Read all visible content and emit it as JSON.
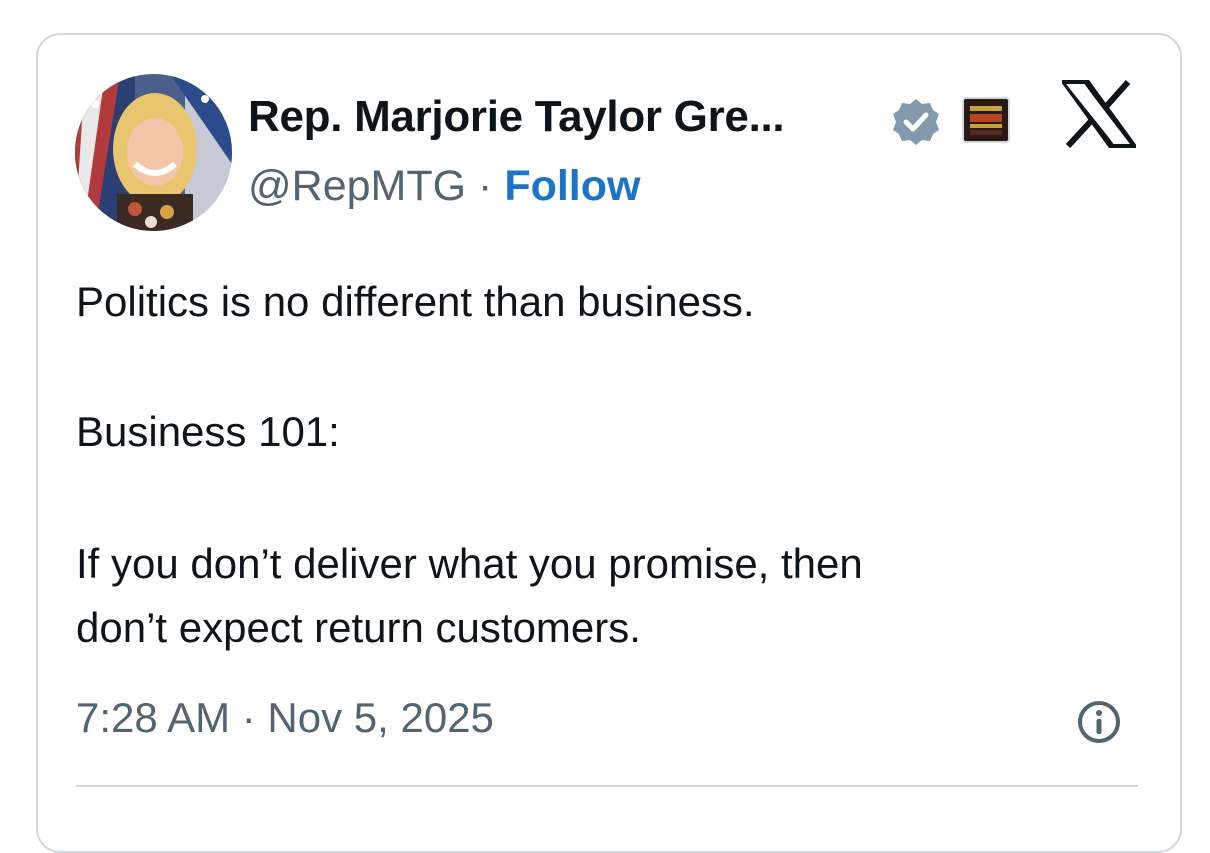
{
  "author": {
    "display_name": "Rep. Marjorie Taylor Gre...",
    "handle": "@RepMTG",
    "separator": "·",
    "follow_label": "Follow",
    "verified_icon": "verified-badge-icon",
    "affiliate_icon": "affiliate-badge-icon"
  },
  "tweet": {
    "lines": [
      "Politics is no different than business.",
      "Business 101:",
      "If you don’t deliver what you promise, then",
      "don’t expect return customers."
    ],
    "timestamp": "7:28 AM · Nov 5, 2025"
  },
  "icons": {
    "logo": "x-logo-icon",
    "info": "info-icon"
  },
  "colors": {
    "follow": "#1d73c9",
    "muted": "#536471",
    "verified": "#829aab",
    "border": "#cfd9de"
  }
}
